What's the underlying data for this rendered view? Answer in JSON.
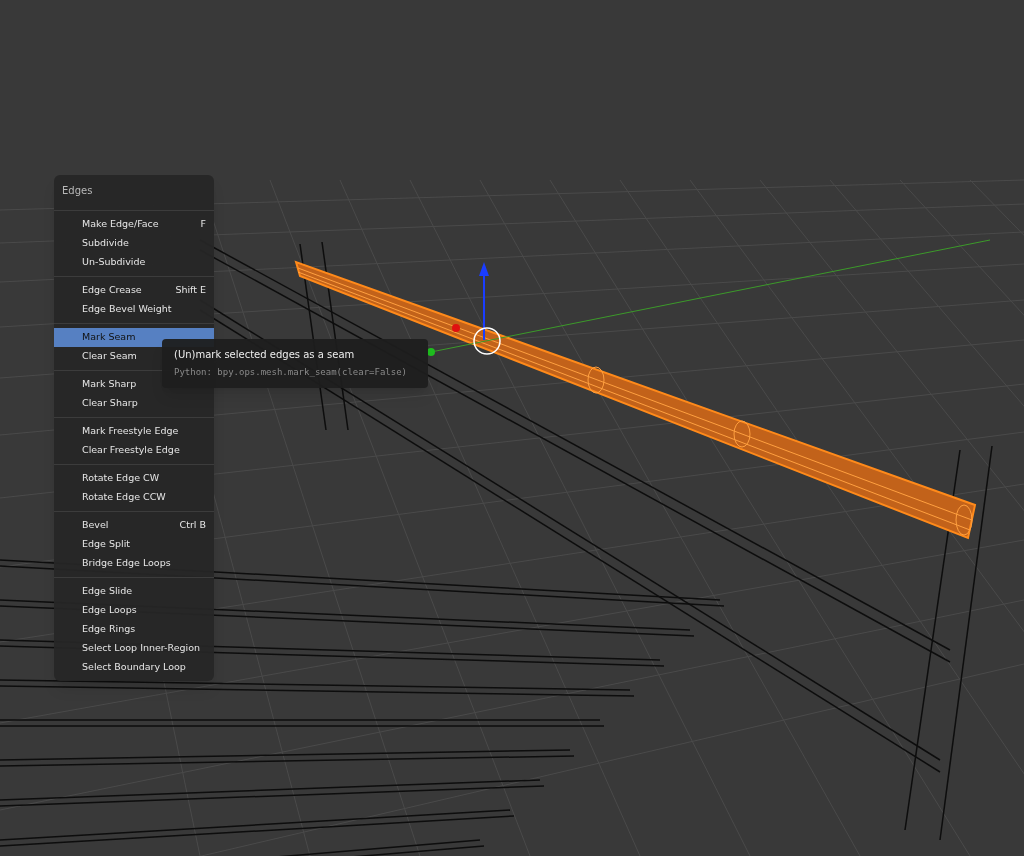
{
  "menu": {
    "title": "Edges",
    "groups": [
      [
        {
          "label": "Make Edge/Face",
          "shortcut": "F",
          "selected": false
        },
        {
          "label": "Subdivide",
          "selected": false
        },
        {
          "label": "Un-Subdivide",
          "selected": false
        }
      ],
      [
        {
          "label": "Edge Crease",
          "shortcut": "Shift E",
          "selected": false
        },
        {
          "label": "Edge Bevel Weight",
          "selected": false
        }
      ],
      [
        {
          "label": "Mark Seam",
          "selected": true
        },
        {
          "label": "Clear Seam",
          "selected": false
        }
      ],
      [
        {
          "label": "Mark Sharp",
          "selected": false
        },
        {
          "label": "Clear Sharp",
          "selected": false
        }
      ],
      [
        {
          "label": "Mark Freestyle Edge",
          "selected": false
        },
        {
          "label": "Clear Freestyle Edge",
          "selected": false
        }
      ],
      [
        {
          "label": "Rotate Edge CW",
          "selected": false
        },
        {
          "label": "Rotate Edge CCW",
          "selected": false
        }
      ],
      [
        {
          "label": "Bevel",
          "shortcut": "Ctrl B",
          "selected": false
        },
        {
          "label": "Edge Split",
          "selected": false
        },
        {
          "label": "Bridge Edge Loops",
          "selected": false
        }
      ],
      [
        {
          "label": "Edge Slide",
          "selected": false
        },
        {
          "label": "Edge Loops",
          "selected": false
        },
        {
          "label": "Edge Rings",
          "selected": false
        },
        {
          "label": "Select Loop Inner-Region",
          "selected": false
        },
        {
          "label": "Select Boundary Loop",
          "selected": false
        }
      ]
    ]
  },
  "tooltip": {
    "description": "(Un)mark selected edges as a seam",
    "python": "Python: bpy.ops.mesh.mark_seam(clear=False)"
  }
}
